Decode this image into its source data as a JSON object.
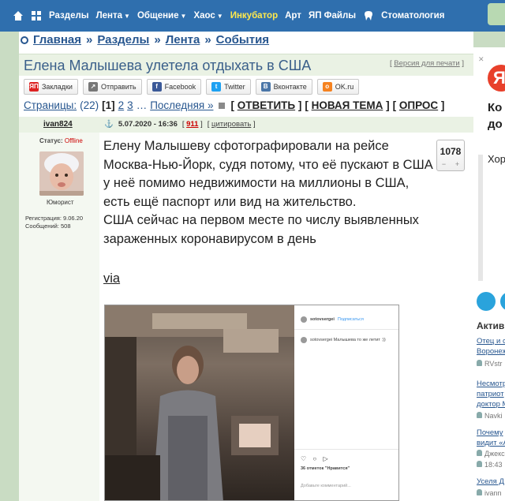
{
  "nav": {
    "items": [
      {
        "label": "Разделы",
        "caret": false
      },
      {
        "label": "Лента",
        "caret": true
      },
      {
        "label": "Общение",
        "caret": true
      },
      {
        "label": "Хаос",
        "caret": true
      },
      {
        "label": "Инкубатор",
        "caret": false,
        "highlight": true
      },
      {
        "label": "Арт",
        "caret": false
      },
      {
        "label": "ЯП Файлы",
        "caret": false
      },
      {
        "label": "Стоматология",
        "caret": false
      }
    ]
  },
  "breadcrumb": [
    "Главная",
    "Разделы",
    "Лента",
    "События"
  ],
  "breadcrumb_sep": "»",
  "topic": {
    "title": "Елена Малышева улетела отдыхать в США",
    "print_version": "Версия для печати"
  },
  "share": [
    "Закладки",
    "Отправить",
    "Facebook",
    "Twitter",
    "Вконтакте",
    "OK.ru"
  ],
  "pager": {
    "label": "Страницы:",
    "count": "(22)",
    "current": "[1]",
    "pages": [
      "2",
      "3"
    ],
    "ellipsis": "…",
    "last": "Последняя »",
    "reply": "ОТВЕТИТЬ",
    "new_topic": "НОВАЯ ТЕМА",
    "poll": "ОПРОС"
  },
  "post": {
    "author": "ivan824",
    "date": "5.07.2020 - 16:36",
    "number": "911",
    "quote": "цитировать",
    "status_label": "Статус:",
    "status": "Offline",
    "rank": "Юморист",
    "registered": "Регистрация: 9.06.20",
    "messages": "Сообщений: 508",
    "rating": "1078",
    "text1": "Елену Малышеву сфотографировали на рейсе Москва-Нью-Йорк, судя потому, что её пускают в США у неё помимо недвижимости на миллионы в США, есть ещё паспорт или вид на жительство.",
    "text2": "США сейчас на первом месте по числу выявленных зараженных коронавирусом в день",
    "via": "via"
  },
  "photo": {
    "ig_user": "sotovsergei",
    "ig_follow": "Подписаться",
    "ig_comment": "sotovsergei Малышева то же летит :))",
    "ig_likes": "36 отметок \"Нравится\"",
    "ig_add": "Добавьте комментарий..."
  },
  "sidebar": {
    "ad_line1": "Ко",
    "ad_line2": "до",
    "ad_line3": "Хор",
    "active_label": "Актив",
    "items": [
      {
        "title": "Отец и с",
        "title2": "Воронеж",
        "author": "RVstr"
      },
      {
        "title": "Несмотр",
        "title2": "патриот",
        "title3": "доктор М",
        "author": "Navki"
      },
      {
        "title": "Почему",
        "title2": "видит «А",
        "author": "Джекс",
        "time": "18:43"
      },
      {
        "title": "Уселя Д",
        "author": "ivann"
      }
    ]
  },
  "colors": {
    "nav": "#2f6fae",
    "link": "#27568f",
    "bg": "#c9dcc3"
  }
}
